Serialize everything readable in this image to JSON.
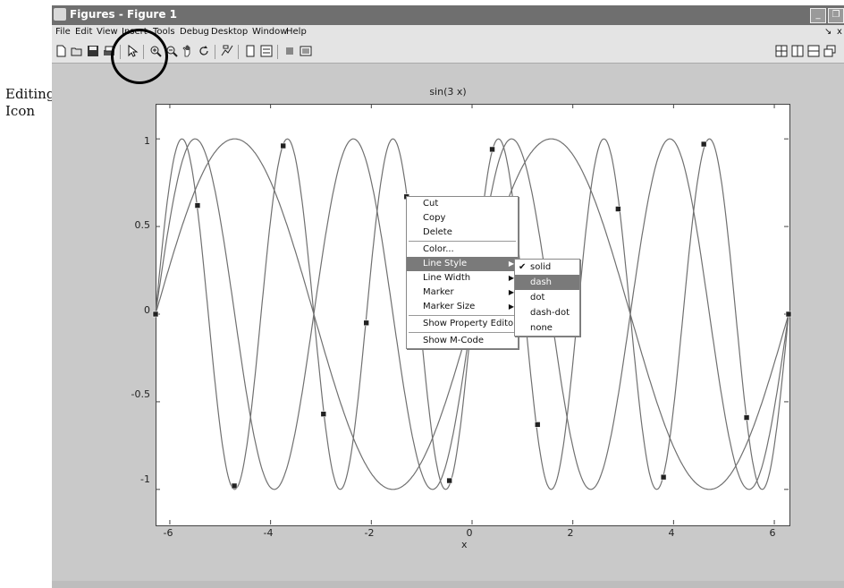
{
  "annotation": {
    "line1": "Editing",
    "line2": "Icon"
  },
  "window": {
    "title": "Figures - Figure 1",
    "buttons": {
      "minimize": "_",
      "restore": "❐"
    }
  },
  "menubar": {
    "items": [
      "File",
      "Edit",
      "View",
      "Insert",
      "Tools",
      "Debug",
      "Desktop",
      "Window",
      "Help"
    ],
    "right": [
      "↘",
      "x"
    ]
  },
  "toolbar": {
    "left_icons": [
      "new-figure-icon",
      "open-file-icon",
      "save-icon",
      "print-icon",
      "edit-plot-icon",
      "zoom-in-icon",
      "zoom-out-icon",
      "pan-hand-icon",
      "rotate-3d-icon",
      "data-cursor-icon",
      "colorbar-icon",
      "legend-icon",
      "hide-plot-tools-icon",
      "show-plot-tools-icon"
    ],
    "right_icons": [
      "tile-layout-icon",
      "split-columns-icon",
      "split-rows-icon",
      "undock-icon"
    ],
    "highlighted": "edit-plot-icon"
  },
  "plot": {
    "title": "sin(3 x)",
    "xlabel": "x"
  },
  "chart_data": {
    "type": "line",
    "title": "sin(3 x)",
    "xlabel": "x",
    "ylabel": "",
    "xlim": [
      -6.283,
      6.283
    ],
    "ylim": [
      -1.2,
      1.2
    ],
    "xticks": [
      "-6",
      "-4",
      "-2",
      "0",
      "2",
      "4",
      "6"
    ],
    "xtick_values": [
      -6,
      -4,
      -2,
      0,
      2,
      4,
      6
    ],
    "yticks": [
      "1",
      "0.5",
      "0",
      "-0.5",
      "-1"
    ],
    "ytick_values": [
      1,
      0.5,
      0,
      -0.5,
      -1
    ],
    "grid": false,
    "series": [
      {
        "frequency": 1
      },
      {
        "frequency": 2
      },
      {
        "frequency": 3
      }
    ],
    "color": "#707070",
    "selection_handles_x": [
      -6.283,
      -5.45,
      -4.72,
      -3.75,
      -2.95,
      -2.1,
      -1.3,
      -0.45,
      0.4,
      1.3,
      2.9,
      3.8,
      4.6,
      5.45,
      6.283
    ],
    "selection_handles_y": [
      0,
      0.62,
      -0.98,
      0.96,
      -0.57,
      -0.05,
      0.67,
      -0.95,
      0.94,
      -0.63,
      0.6,
      -0.93,
      0.97,
      -0.59,
      0
    ]
  },
  "context_menu": {
    "items": [
      "Cut",
      "Copy",
      "Delete",
      "Color...",
      "Line Style",
      "Line Width",
      "Marker",
      "Marker Size",
      "Show Property Editor",
      "Show M-Code"
    ],
    "active": "Line Style"
  },
  "submenu": {
    "items": [
      "solid",
      "dash",
      "dot",
      "dash-dot",
      "none"
    ],
    "checked": "solid",
    "active": "dash",
    "check_glyph": "✔"
  },
  "submenu_arrow": "▶"
}
